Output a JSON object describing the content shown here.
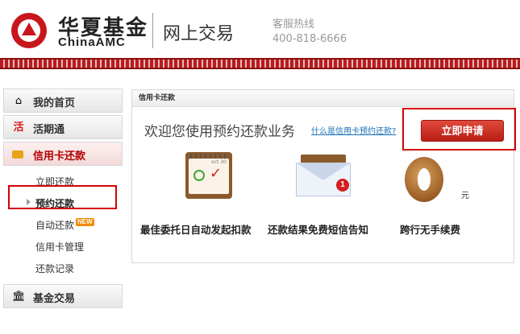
{
  "header": {
    "brand_cn": "华夏基金",
    "brand_en": "ChinaAMC",
    "site_title": "网上交易",
    "hotline_label": "客服热线",
    "hotline_number": "400-818-6666"
  },
  "sidebar": {
    "home": "我的首页",
    "huoqitong": "活期通",
    "credit_repay": "信用卡还款",
    "sub_items": [
      "立即还款",
      "预约还款",
      "自动还款",
      "信用卡管理",
      "还款记录"
    ],
    "new_badge": "NEW",
    "fund_trade": "基金交易"
  },
  "panel": {
    "title": "信用卡还款",
    "welcome": "欢迎您使用预约还款业务",
    "what_is_link": "什么是信用卡预约还款?",
    "apply_button": "立即申请",
    "calendar_text": "oct 30",
    "envelope_badge": "1",
    "yuan": "元",
    "features": [
      "最佳委托日自动发起扣款",
      "还款结果免费短信告知",
      "跨行无手续费"
    ]
  }
}
